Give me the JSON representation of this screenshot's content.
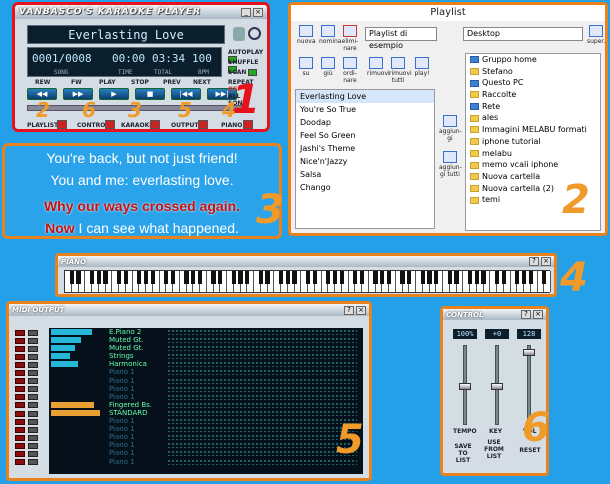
{
  "player": {
    "title": "VANBASCO'S KARAOKE PLAYER",
    "song": "Everlasting Love",
    "display": {
      "song_no": "0001/0008",
      "time": "00:00",
      "total": "03:34",
      "bpm": "100"
    },
    "display_labels": [
      "SONG",
      "TIME",
      "TOTAL",
      "BPM"
    ],
    "transport": [
      "REW",
      "FW",
      "PLAY",
      "STOP",
      "PREV",
      "NEXT"
    ],
    "toggles": [
      "AUTOPLAY",
      "SHUFFLE",
      "SCAN"
    ],
    "repeat": {
      "label": "REPEAT",
      "options": [
        "OFF",
        "ALL",
        "SONG"
      ]
    },
    "bottom": [
      "PLAYLIST",
      "CONTROL",
      "KARAOKE",
      "OUTPUT",
      "PIANO"
    ]
  },
  "callouts": [
    "1",
    "2",
    "3",
    "4",
    "5",
    "6"
  ],
  "small_callouts": [
    "2",
    "6",
    "3",
    "5",
    "4"
  ],
  "lyrics": {
    "line1": "You're back, but not just friend!",
    "line2": "You and me: everlasting love.",
    "line3": "Why our ways crossed again.",
    "line4_a": "Now",
    "line4_b": " I can see what happened."
  },
  "playlist": {
    "title": "Playlist",
    "buttons_top": [
      "nuova",
      "nomina",
      "elimi-nare"
    ],
    "buttons_mid": [
      "su",
      "giù",
      "ordi-nare",
      "rimuovi",
      "rimuovi tutti",
      "play!"
    ],
    "select_playlist": "Playlist di esempio",
    "select_folder": "Desktop",
    "super": "super.",
    "aggiungi": "aggiun-gi",
    "aggiungi_tutti": "aggiun-gi tutti",
    "songs": [
      "Everlasting Love",
      "You're So True",
      "Doodap",
      "Feel So Green",
      "Jashi's Theme",
      "Nice'n'Jazzy",
      "Salsa",
      "Chango"
    ],
    "folders": [
      "Gruppo home",
      "Stefano",
      "Questo PC",
      "Raccolte",
      "Rete",
      "ales",
      "Immagini MELABU formati",
      "iphone tutorial",
      "melabu",
      "memo vcali iphone",
      "Nuova cartella",
      "Nuova cartella (2)",
      "temi"
    ]
  },
  "piano": {
    "title": "PIANO"
  },
  "midi": {
    "title": "MIDI OUTPUT",
    "channels": [
      {
        "name": "E.Piano 2",
        "level": 0.75,
        "active": true
      },
      {
        "name": "Muted Gt.",
        "level": 0.55,
        "active": true
      },
      {
        "name": "Muted Gt.",
        "level": 0.45,
        "active": true
      },
      {
        "name": "Strings",
        "level": 0.35,
        "active": true
      },
      {
        "name": "Harmonica",
        "level": 0.5,
        "active": true
      },
      {
        "name": "Piano 1",
        "level": 0,
        "active": false
      },
      {
        "name": "Piano 1",
        "level": 0,
        "active": false
      },
      {
        "name": "Piano 1",
        "level": 0,
        "active": false
      },
      {
        "name": "Piano 1",
        "level": 0,
        "active": false
      },
      {
        "name": "Fingered Bs.",
        "level": 0.8,
        "active": true
      },
      {
        "name": "STANDARD",
        "level": 0.9,
        "active": true
      },
      {
        "name": "Piano 1",
        "level": 0,
        "active": false
      },
      {
        "name": "Piano 1",
        "level": 0,
        "active": false
      },
      {
        "name": "Piano 1",
        "level": 0,
        "active": false
      },
      {
        "name": "Piano 1",
        "level": 0,
        "active": false
      },
      {
        "name": "Piano 1",
        "level": 0,
        "active": false
      },
      {
        "name": "Piano 1",
        "level": 0,
        "active": false
      }
    ]
  },
  "control": {
    "title": "CONTROL",
    "values": {
      "tempo": "100%",
      "key": "+0",
      "vol": "128"
    },
    "labels": [
      "TEMPO",
      "KEY",
      "VOL"
    ],
    "buttons": [
      "SAVE TO LIST",
      "USE FROM LIST",
      "RESET"
    ]
  },
  "colors": {
    "callout_red": "#e8121c",
    "callout_orange": "#f09a2a",
    "bg": "#23a0e8"
  }
}
